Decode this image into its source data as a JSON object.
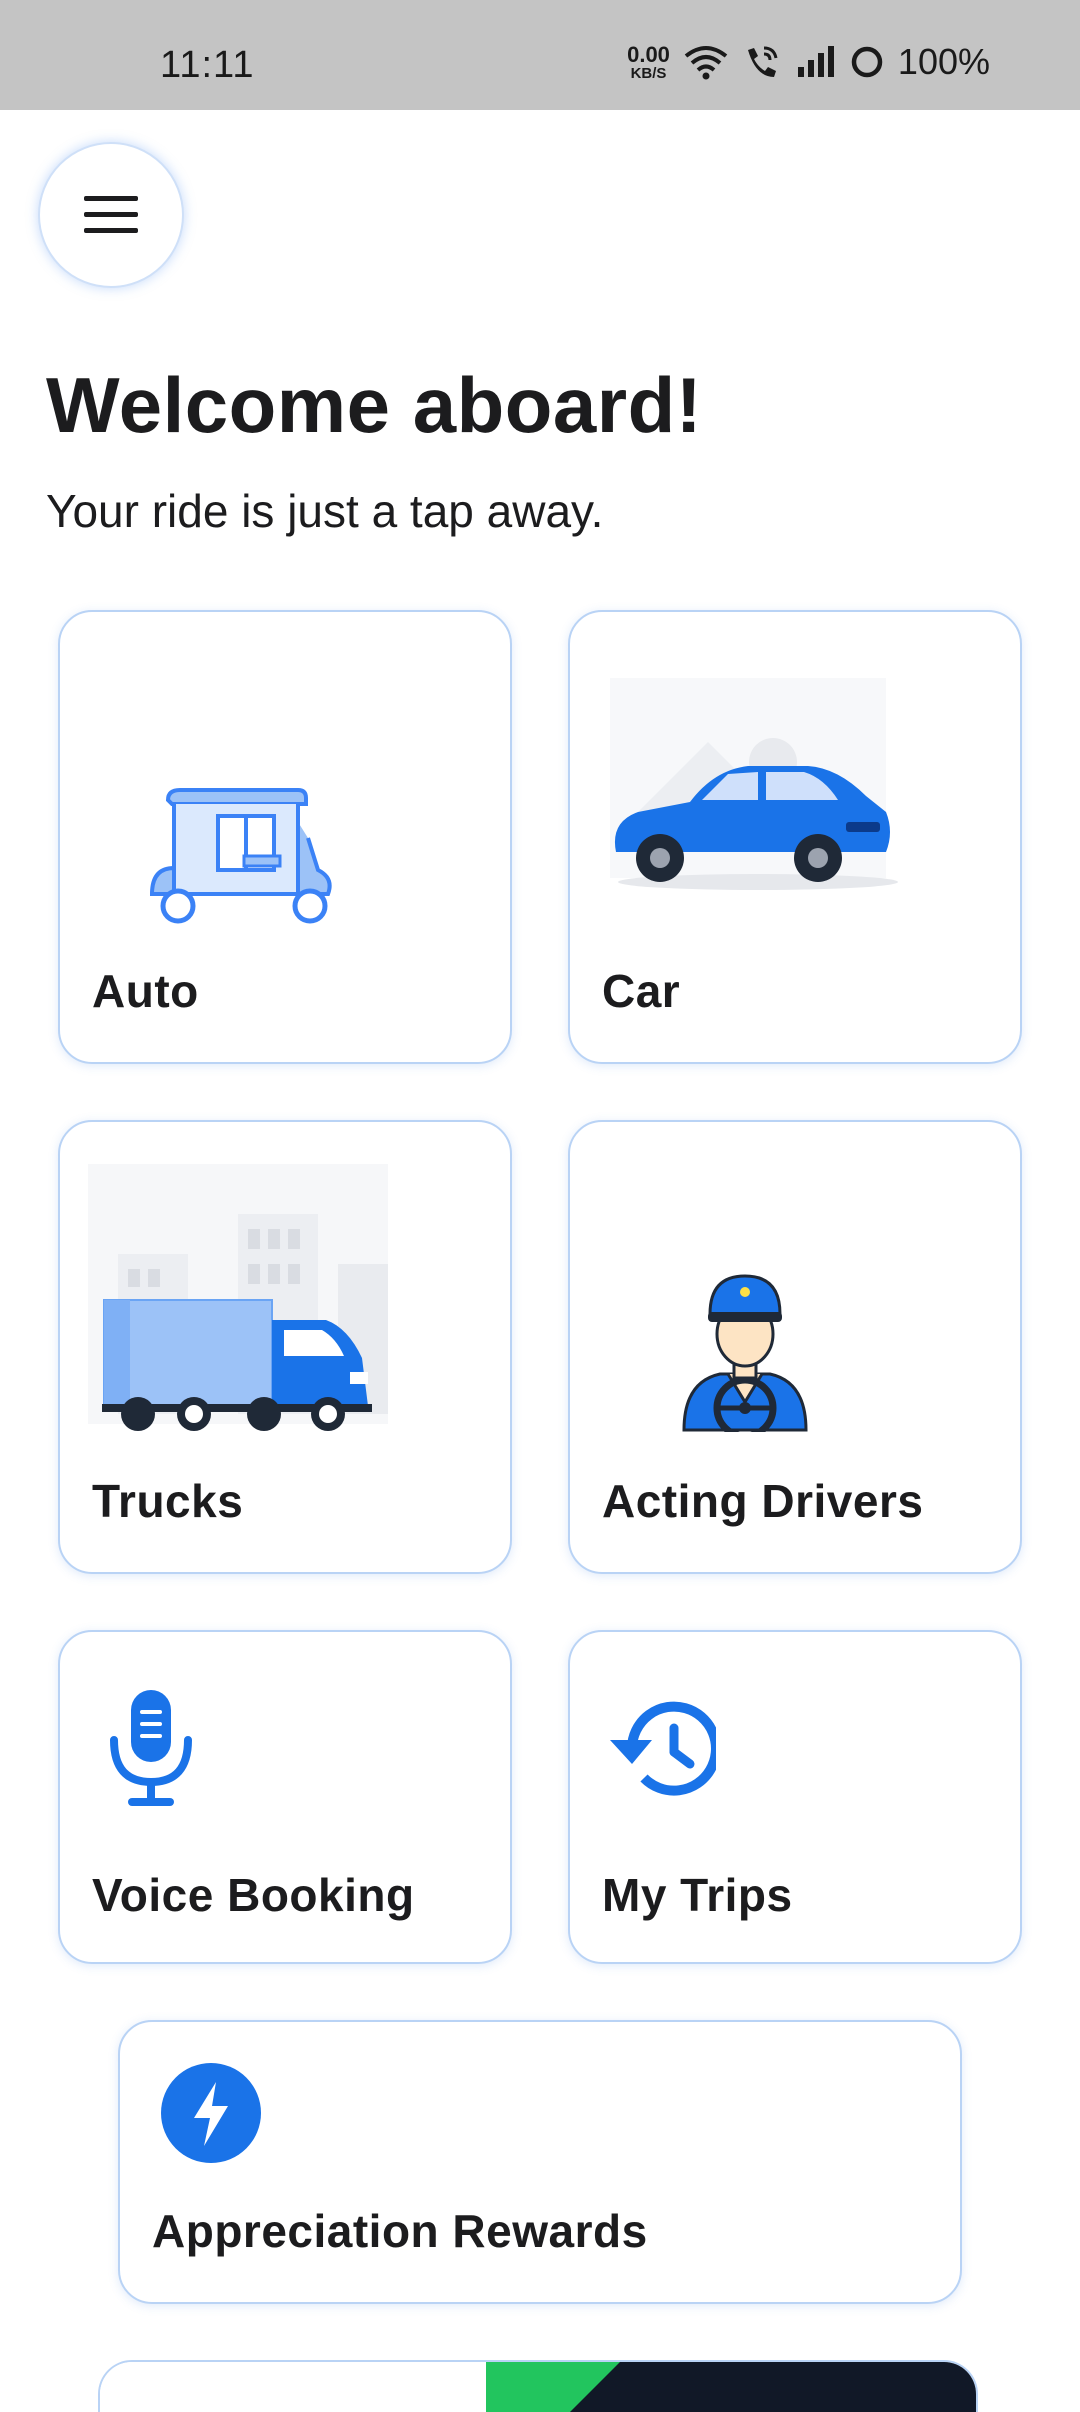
{
  "status_bar": {
    "time": "11:11",
    "net_speed_value": "0.00",
    "net_speed_unit": "KB/S",
    "battery": "100%"
  },
  "menu": {
    "icon": "hamburger-icon"
  },
  "header": {
    "title": "Welcome aboard!",
    "subtitle": "Your ride is just a tap away."
  },
  "services": [
    {
      "label": "Auto",
      "icon": "auto-rickshaw-icon"
    },
    {
      "label": "Car",
      "icon": "car-icon"
    },
    {
      "label": "Trucks",
      "icon": "truck-icon"
    },
    {
      "label": "Acting Drivers",
      "icon": "driver-icon"
    },
    {
      "label": "Voice Booking",
      "icon": "microphone-icon"
    },
    {
      "label": "My Trips",
      "icon": "history-icon"
    },
    {
      "label": "Appreciation Rewards",
      "icon": "lightning-icon"
    }
  ],
  "colors": {
    "accent": "#1a73e8",
    "card_border": "#b9d3f5",
    "text": "#1c1c1e",
    "status_bar": "#c4c4c4"
  }
}
